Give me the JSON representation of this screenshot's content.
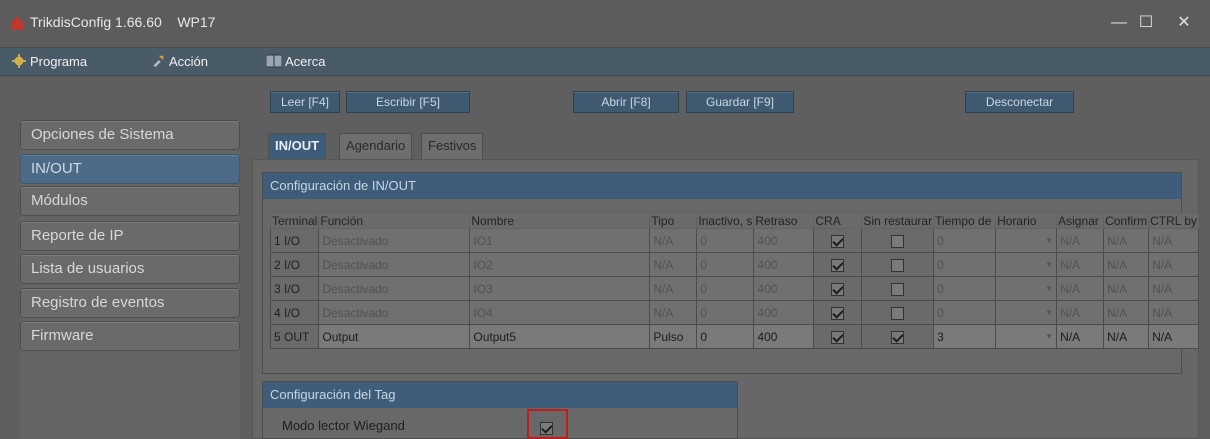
{
  "window": {
    "title": "TrikdisConfig 1.66.60",
    "device": "WP17",
    "controls": {
      "minimize": "—",
      "maximize": "☐",
      "close": "✕"
    }
  },
  "menu": [
    {
      "label": "Programa",
      "icon": "gear-icon"
    },
    {
      "label": "Acción",
      "icon": "action-icon"
    },
    {
      "label": "Acerca",
      "icon": "book-icon"
    }
  ],
  "toolbar": {
    "read": "Leer [F4]",
    "write": "Escribir [F5]",
    "open": "Abrir [F8]",
    "save": "Guardar [F9]",
    "disconnect": "Desconectar"
  },
  "sidebar": [
    {
      "label": "Opciones de Sistema",
      "active": false
    },
    {
      "label": "IN/OUT",
      "active": true
    },
    {
      "label": "Módulos",
      "active": false
    },
    {
      "label": "Reporte de IP",
      "active": false
    },
    {
      "label": "Lista de usuarios",
      "active": false
    },
    {
      "label": "Registro de eventos",
      "active": false
    },
    {
      "label": "Firmware",
      "active": false
    }
  ],
  "tabs": [
    {
      "label": "IN/OUT",
      "active": true
    },
    {
      "label": "Agendario",
      "active": false
    },
    {
      "label": "Festivos",
      "active": false
    }
  ],
  "io_group": {
    "title": "Configuración de IN/OUT",
    "columns": [
      "Terminal",
      "Función",
      "Nombre",
      "Tipo",
      "Inactivo, s",
      "Retraso",
      "CRA",
      "Sin restaurar",
      "Tiempo de",
      "Horario",
      "Asignar",
      "Confirm",
      "CTRL by"
    ],
    "rows": [
      {
        "terminal": "1 I/O",
        "funcion": "Desactivado",
        "nombre": "IO1",
        "tipo": "N/A",
        "inactivo": "0",
        "retraso": "400",
        "cra": true,
        "sin_rest": false,
        "tiempo": "0",
        "horario": "",
        "asignar": "N/A",
        "confirm": "N/A",
        "ctrl": "N/A"
      },
      {
        "terminal": "2 I/O",
        "funcion": "Desactivado",
        "nombre": "IO2",
        "tipo": "N/A",
        "inactivo": "0",
        "retraso": "400",
        "cra": true,
        "sin_rest": false,
        "tiempo": "0",
        "horario": "",
        "asignar": "N/A",
        "confirm": "N/A",
        "ctrl": "N/A"
      },
      {
        "terminal": "3 I/O",
        "funcion": "Desactivado",
        "nombre": "IO3",
        "tipo": "N/A",
        "inactivo": "0",
        "retraso": "400",
        "cra": true,
        "sin_rest": false,
        "tiempo": "0",
        "horario": "",
        "asignar": "N/A",
        "confirm": "N/A",
        "ctrl": "N/A"
      },
      {
        "terminal": "4 I/O",
        "funcion": "Desactivado",
        "nombre": "IO4",
        "tipo": "N/A",
        "inactivo": "0",
        "retraso": "400",
        "cra": true,
        "sin_rest": false,
        "tiempo": "0",
        "horario": "",
        "asignar": "N/A",
        "confirm": "N/A",
        "ctrl": "N/A"
      },
      {
        "terminal": "5 OUT",
        "funcion": "Output",
        "nombre": "Output5",
        "tipo": "Pulso",
        "inactivo": "0",
        "retraso": "400",
        "cra": true,
        "sin_rest": true,
        "tiempo": "3",
        "horario": "",
        "asignar": "N/A",
        "confirm": "N/A",
        "ctrl": "N/A"
      }
    ]
  },
  "tag_group": {
    "title": "Configuración del Tag",
    "wiegand_label": "Modo lector Wiegand",
    "wiegand_checked": true
  },
  "colors": {
    "accent": "#3e5d7a",
    "highlight_box": "#c41a1a",
    "app_icon": "#c0392b"
  }
}
